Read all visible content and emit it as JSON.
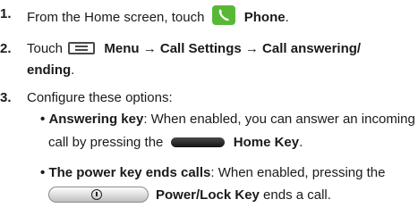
{
  "steps": [
    {
      "num": "1.",
      "pre": "From the Home screen, touch",
      "bold": "Phone",
      "post": "."
    },
    {
      "num": "2.",
      "pre": "Touch",
      "bold_1": "Menu → Call Settings → Call answering/",
      "bold_2": "ending",
      "post": "."
    },
    {
      "num": "3.",
      "text": "Configure these options:"
    }
  ],
  "options": [
    {
      "bullet": "•",
      "title": "Answering key",
      "desc_1": ": When enabled, you can answer an incoming",
      "desc_2_pre": "call by pressing the",
      "key_label": "Home Key",
      "post": "."
    },
    {
      "bullet": "•",
      "title": "The power key ends calls",
      "desc_1": ": When enabled, pressing the",
      "key_label": "Power/Lock Key",
      "post": " ends a call."
    }
  ],
  "icons": {
    "phone": "phone-app-icon",
    "menu": "menu-key-icon",
    "home": "home-key-icon",
    "power": "power-lock-key-icon",
    "phone_color": "#58b836"
  }
}
